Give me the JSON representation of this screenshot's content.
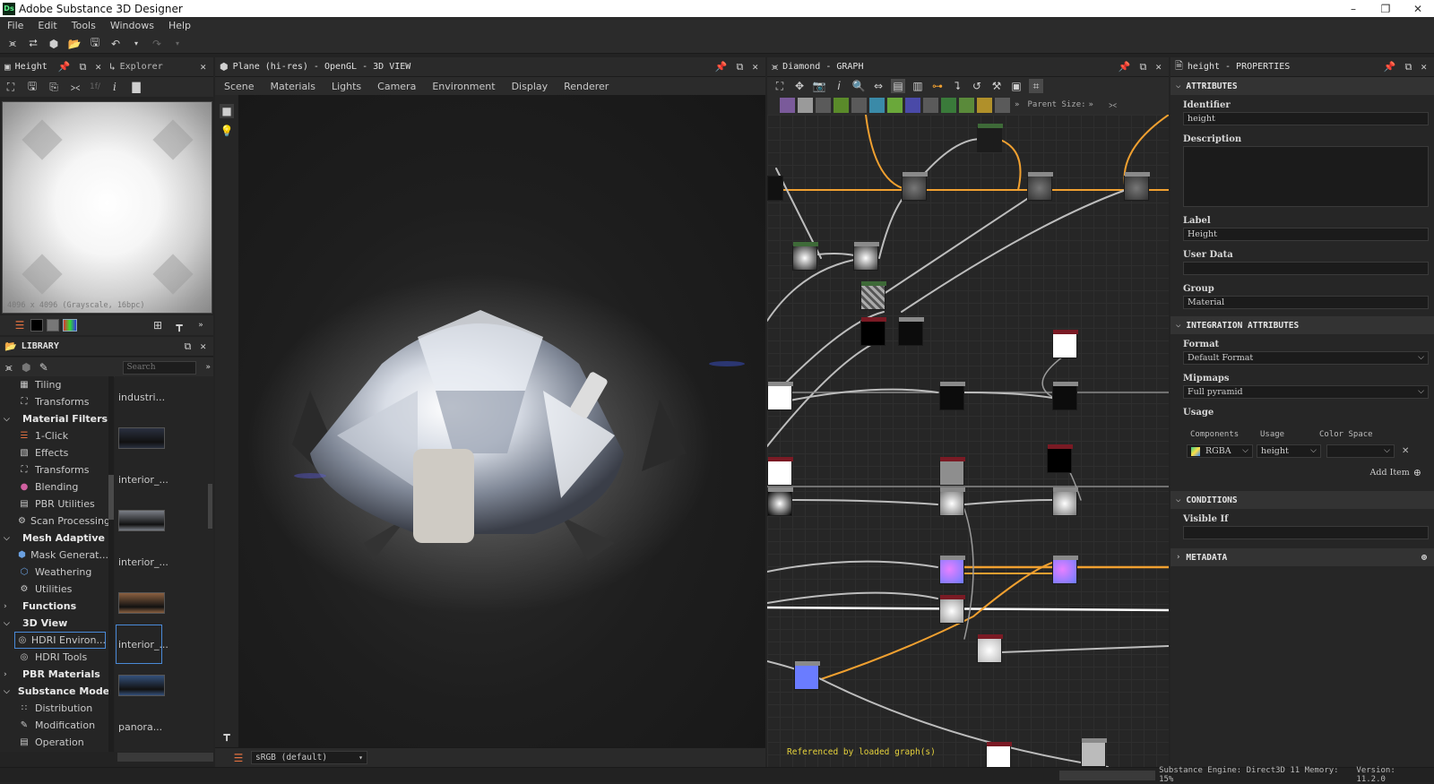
{
  "window": {
    "title": "Adobe Substance 3D Designer",
    "logo": "Ds"
  },
  "menu": [
    "File",
    "Edit",
    "Tools",
    "Windows",
    "Help"
  ],
  "height_panel": {
    "tab_height": "Height",
    "tab_explorer": "Explorer",
    "preview_caption": "4096 x 4096 (Grayscale, 16bpc)",
    "toolbar_value": "1f/"
  },
  "library": {
    "title": "LIBRARY",
    "search_placeholder": "Search",
    "tree": [
      {
        "type": "item",
        "label": "Tiling",
        "icon": "tiling-icon"
      },
      {
        "type": "item",
        "label": "Transforms",
        "icon": "transforms-icon"
      },
      {
        "type": "cat",
        "label": "Material Filters",
        "expanded": true
      },
      {
        "type": "item",
        "label": "1-Click",
        "icon": "layers-icon"
      },
      {
        "type": "item",
        "label": "Effects",
        "icon": "effects-icon"
      },
      {
        "type": "item",
        "label": "Transforms",
        "icon": "transforms-icon"
      },
      {
        "type": "item",
        "label": "Blending",
        "icon": "blending-icon"
      },
      {
        "type": "item",
        "label": "PBR Utilities",
        "icon": "pbr-utilities-icon"
      },
      {
        "type": "item",
        "label": "Scan Processing",
        "icon": "gear-icon"
      },
      {
        "type": "cat",
        "label": "Mesh Adaptive",
        "expanded": true
      },
      {
        "type": "item",
        "label": "Mask Generat...",
        "icon": "mask-icon"
      },
      {
        "type": "item",
        "label": "Weathering",
        "icon": "weathering-icon"
      },
      {
        "type": "item",
        "label": "Utilities",
        "icon": "utilities-icon"
      },
      {
        "type": "cat",
        "label": "Functions",
        "expanded": false
      },
      {
        "type": "cat",
        "label": "3D View",
        "expanded": true
      },
      {
        "type": "item",
        "label": "HDRI Environ...",
        "icon": "globe-icon",
        "selected": true
      },
      {
        "type": "item",
        "label": "HDRI Tools",
        "icon": "globe-icon"
      },
      {
        "type": "cat",
        "label": "PBR Materials",
        "expanded": false
      },
      {
        "type": "cat",
        "label": "Substance Mode...",
        "expanded": true
      },
      {
        "type": "item",
        "label": "Distribution",
        "icon": "distribution-icon"
      },
      {
        "type": "item",
        "label": "Modification",
        "icon": "modification-icon"
      },
      {
        "type": "item",
        "label": "Operation",
        "icon": "operation-icon"
      }
    ],
    "thumbs": [
      {
        "label": "industri...",
        "kind": "text"
      },
      {
        "label": "",
        "kind": "image",
        "color": "#2a3040"
      },
      {
        "label": "interior_...",
        "kind": "text"
      },
      {
        "label": "",
        "kind": "image",
        "color": "#7a7e86"
      },
      {
        "label": "interior_...",
        "kind": "text"
      },
      {
        "label": "",
        "kind": "image",
        "color": "#8a6040"
      },
      {
        "label": "interior_...",
        "kind": "text",
        "selected": true
      },
      {
        "label": "",
        "kind": "image",
        "color": "#34507a"
      },
      {
        "label": "panora...",
        "kind": "text"
      }
    ]
  },
  "view3d": {
    "title": "Plane (hi-res) - OpenGL - 3D VIEW",
    "menu": [
      "Scene",
      "Materials",
      "Lights",
      "Camera",
      "Environment",
      "Display",
      "Renderer"
    ],
    "colorspace": "sRGB (default)"
  },
  "graph": {
    "title": "Diamond - GRAPH",
    "parent_size_label": "Parent Size:",
    "status": "Referenced by loaded graph(s)"
  },
  "properties": {
    "title": "height - PROPERTIES",
    "attributes_header": "ATTRIBUTES",
    "identifier_label": "Identifier",
    "identifier_value": "height",
    "description_label": "Description",
    "description_value": "",
    "label_label": "Label",
    "label_value": "Height",
    "userdata_label": "User Data",
    "userdata_value": "",
    "group_label": "Group",
    "group_value": "Material",
    "integration_header": "INTEGRATION ATTRIBUTES",
    "format_label": "Format",
    "format_value": "Default Format",
    "mipmaps_label": "Mipmaps",
    "mipmaps_value": "Full pyramid",
    "usage_label": "Usage",
    "col_components": "Components",
    "col_usage": "Usage",
    "col_colorspace": "Color Space",
    "row_components": "RGBA",
    "row_usage": "height",
    "row_colorspace": "",
    "add_item": "Add Item",
    "conditions_header": "CONDITIONS",
    "visible_if_label": "Visible If",
    "visible_if_value": "",
    "metadata_header": "METADATA"
  },
  "statusbar": {
    "engine": "Substance Engine: Direct3D 11 Memory: 15%",
    "version": "Version: 11.2.0"
  },
  "colors": {
    "accent_orange": "#f0a030",
    "selection_blue": "#4a8ad8",
    "status_yellow": "#e6d23c"
  }
}
